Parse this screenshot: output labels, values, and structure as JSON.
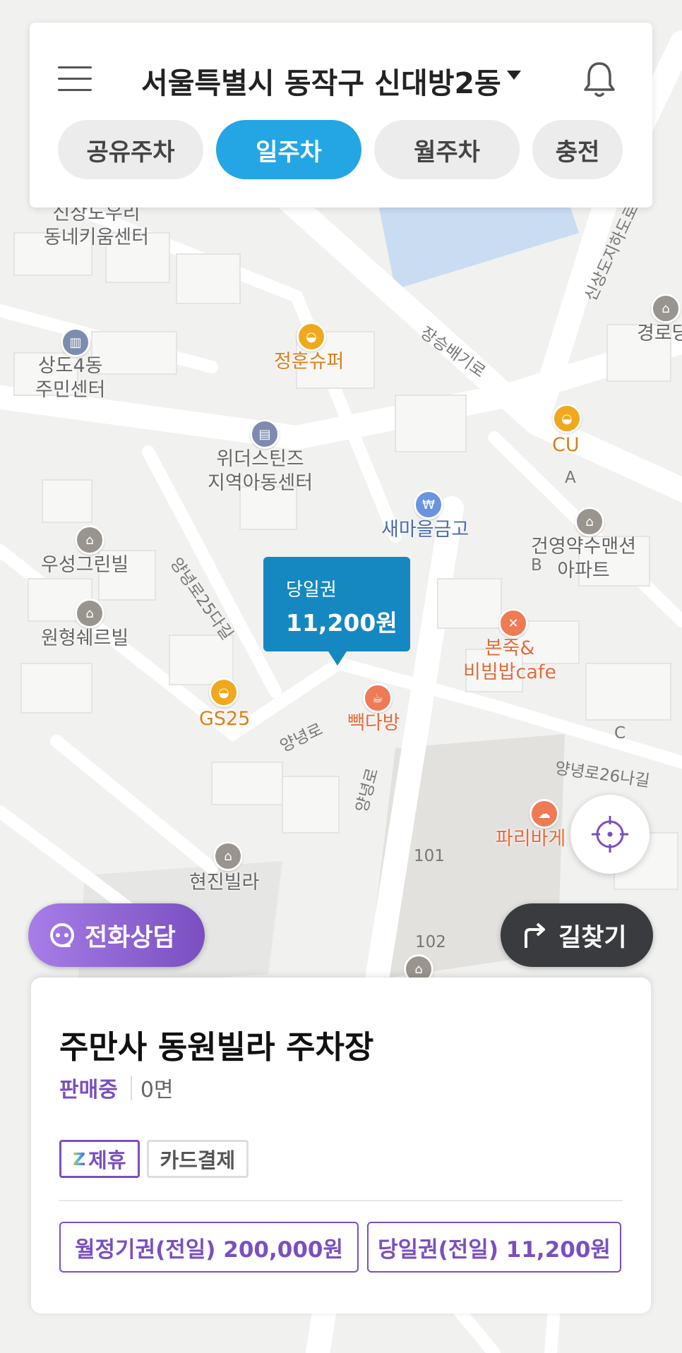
{
  "header": {
    "menu_icon": "hamburger-icon",
    "location": "서울특별시 동작구 신대방2동",
    "notification_icon": "bell-icon",
    "tabs": [
      {
        "label": "공유주차",
        "active": false
      },
      {
        "label": "일주차",
        "active": true
      },
      {
        "label": "월주차",
        "active": false
      },
      {
        "label": "충전",
        "active": false
      }
    ]
  },
  "map": {
    "places": [
      {
        "name": "신상도우리\n동네키움센터",
        "icon": "building-icon"
      },
      {
        "name": "상도4동\n주민센터",
        "icon": "government-icon"
      },
      {
        "name": "정훈슈퍼",
        "icon": "shopping-basket-icon"
      },
      {
        "name": "위더스틴즈\n지역아동센터",
        "icon": "building-icon"
      },
      {
        "name": "새마을금고",
        "icon": "won-icon"
      },
      {
        "name": "CU",
        "icon": "shopping-basket-icon"
      },
      {
        "name": "건영약수맨션\n아파트",
        "icon": "house-icon"
      },
      {
        "name": "경로당",
        "icon": "house-icon"
      },
      {
        "name": "우성그린빌",
        "icon": "house-icon"
      },
      {
        "name": "원형쉐르빌",
        "icon": "house-icon"
      },
      {
        "name": "GS25",
        "icon": "shopping-basket-icon"
      },
      {
        "name": "빽다방",
        "icon": "coffee-icon"
      },
      {
        "name": "본죽&\n비빔밥cafe",
        "icon": "restaurant-icon"
      },
      {
        "name": "파리바게",
        "icon": "bakery-icon"
      },
      {
        "name": "현진빌라",
        "icon": "house-icon"
      }
    ],
    "roads": [
      "장승배기로",
      "양녕로25다길",
      "양녕로",
      "양녕로",
      "양녕로26나길",
      "신상도지하도로"
    ],
    "markers": [
      "A",
      "B",
      "C",
      "101",
      "102",
      "101",
      "102"
    ],
    "pin": {
      "label": "당일권",
      "price": "11,200원"
    }
  },
  "buttons": {
    "locate_icon": "crosshair-icon",
    "call": "전화상담",
    "route": "길찾기"
  },
  "lot": {
    "name": "주만사 동원빌라 주차장",
    "status": "판매중",
    "count": "0면",
    "tags": [
      "제휴",
      "카드결제"
    ],
    "tickets": [
      "월정기권(전일) 200,000원",
      "당일권(전일) 11,200원"
    ]
  },
  "colors": {
    "accent_blue": "#23a6e3",
    "purple": "#7a4fc0",
    "pin_blue": "#1688c1"
  }
}
